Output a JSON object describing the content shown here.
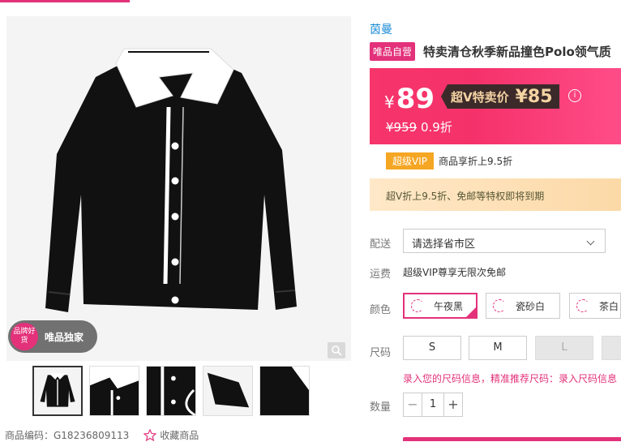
{
  "product": {
    "brand": "茵曼",
    "self_badge": "唯品自营",
    "title": "特卖清仓秋季新品撞色Polo领气质"
  },
  "gallery": {
    "overlay_circle": "品牌好货",
    "overlay_text": "唯品独家",
    "zoom_icon": "search-icon",
    "thumbnails": [
      "front",
      "collar",
      "placket",
      "sleeve",
      "hem"
    ]
  },
  "price": {
    "currency": "¥",
    "current": "89",
    "vip_label": "超V特卖价",
    "vip_price": "¥85",
    "original": "¥959",
    "discount": "0.9折"
  },
  "vip": {
    "badge": "超级VIP",
    "desc": "商品享折上9.5折"
  },
  "notice": "超V折上9.5折、免邮等特权即将到期",
  "delivery": {
    "label": "配送",
    "placeholder": "请选择省市区"
  },
  "shipping": {
    "label": "运费",
    "value": "超级VIP尊享无限次免邮"
  },
  "color": {
    "label": "颜色",
    "options": [
      "午夜黑",
      "瓷砂白",
      "茶白"
    ],
    "selected": "午夜黑"
  },
  "size": {
    "label": "尺码",
    "options": [
      "S",
      "M",
      "L"
    ],
    "disabled": [
      "L"
    ],
    "tip": "录入您的尺码信息，精准推荐尺码：录入尺码信息"
  },
  "quantity": {
    "label": "数量",
    "value": "1",
    "minus": "−",
    "plus": "+"
  },
  "meta": {
    "code": "商品编码：G18236809113",
    "fav": "收藏商品"
  },
  "colors": {
    "accent": "#e3317a",
    "price_bg": "#f6356b",
    "vip_gold": "#f5a623",
    "brand_blue": "#1a8bd6"
  }
}
